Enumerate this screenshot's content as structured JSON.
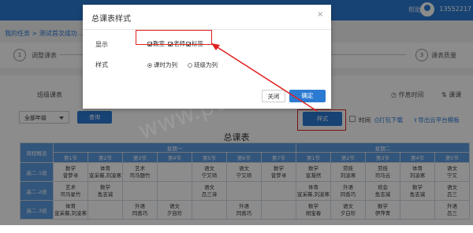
{
  "topbar": {
    "help": "帮助",
    "phone": "13552217"
  },
  "breadcrumb": "我的任务 > 测试首次成功...",
  "steps": [
    {
      "num": "1",
      "label": "调整课表"
    },
    {
      "num": "3",
      "label": "课表质量"
    }
  ],
  "tabs": {
    "class_table": "班级课表",
    "rest_time": "作息时间",
    "lesson": "课课"
  },
  "toolbar": {
    "grade": "全部年级",
    "query": "查询",
    "style": "样式",
    "time": "时间",
    "print": "打包下载",
    "export": "导出云平台模板"
  },
  "table": {
    "title": "总课表",
    "corner": "周程概览",
    "days": [
      "星期一",
      "星期二"
    ],
    "periods": [
      "第1节",
      "第2节",
      "第3节",
      "第4节",
      "第5节",
      "第6节",
      "第7节",
      "第1节",
      "第2节",
      "第3节",
      "第4节",
      "第5节"
    ],
    "rows": [
      {
        "name": "高二-1班",
        "cells": [
          "数学\n曾梦寻",
          "体育\n宣采薇,刘凌寒",
          "艺术\n司马题竹",
          "",
          "语文\n宁又琦",
          "语文\n宁又琦",
          "数学\n曾梦寻",
          "数学\n宣凝然",
          "劳技\n刘凌寒",
          "劳技\n司马云",
          "体育\n刘凌寒",
          "语文\n宁又"
        ]
      },
      {
        "name": "高二-2班",
        "cells": [
          "艺术\n司马星竹",
          "数学\n鱼志诚",
          "",
          "",
          "语文\n吕三诗",
          "",
          "",
          "体育\n宣采薇,刘凌寒",
          "外语\n同香巧",
          "班会\n鱼志诚",
          "数学\n鱼志诚",
          "语文\n吕三"
        ]
      },
      {
        "name": "高二-3班",
        "cells": [
          "体育\n宣采薇,刘凌寒",
          "",
          "外语\n同香巧",
          "语文\n夕自珍",
          "",
          "外语\n同香巧",
          "",
          "数学\n胡宝春",
          "语文\n夕白珍",
          "数学\n伊萍青",
          "",
          "外语\n吕三"
        ]
      }
    ]
  },
  "modal": {
    "title": "总课表样式",
    "close": "×",
    "display_label": "显示",
    "display_options": [
      "教室",
      "老师",
      "标签"
    ],
    "style_label": "样式",
    "style_options": [
      "课时为列",
      "班级为列"
    ],
    "cancel": "关闭",
    "confirm": "确定"
  }
}
